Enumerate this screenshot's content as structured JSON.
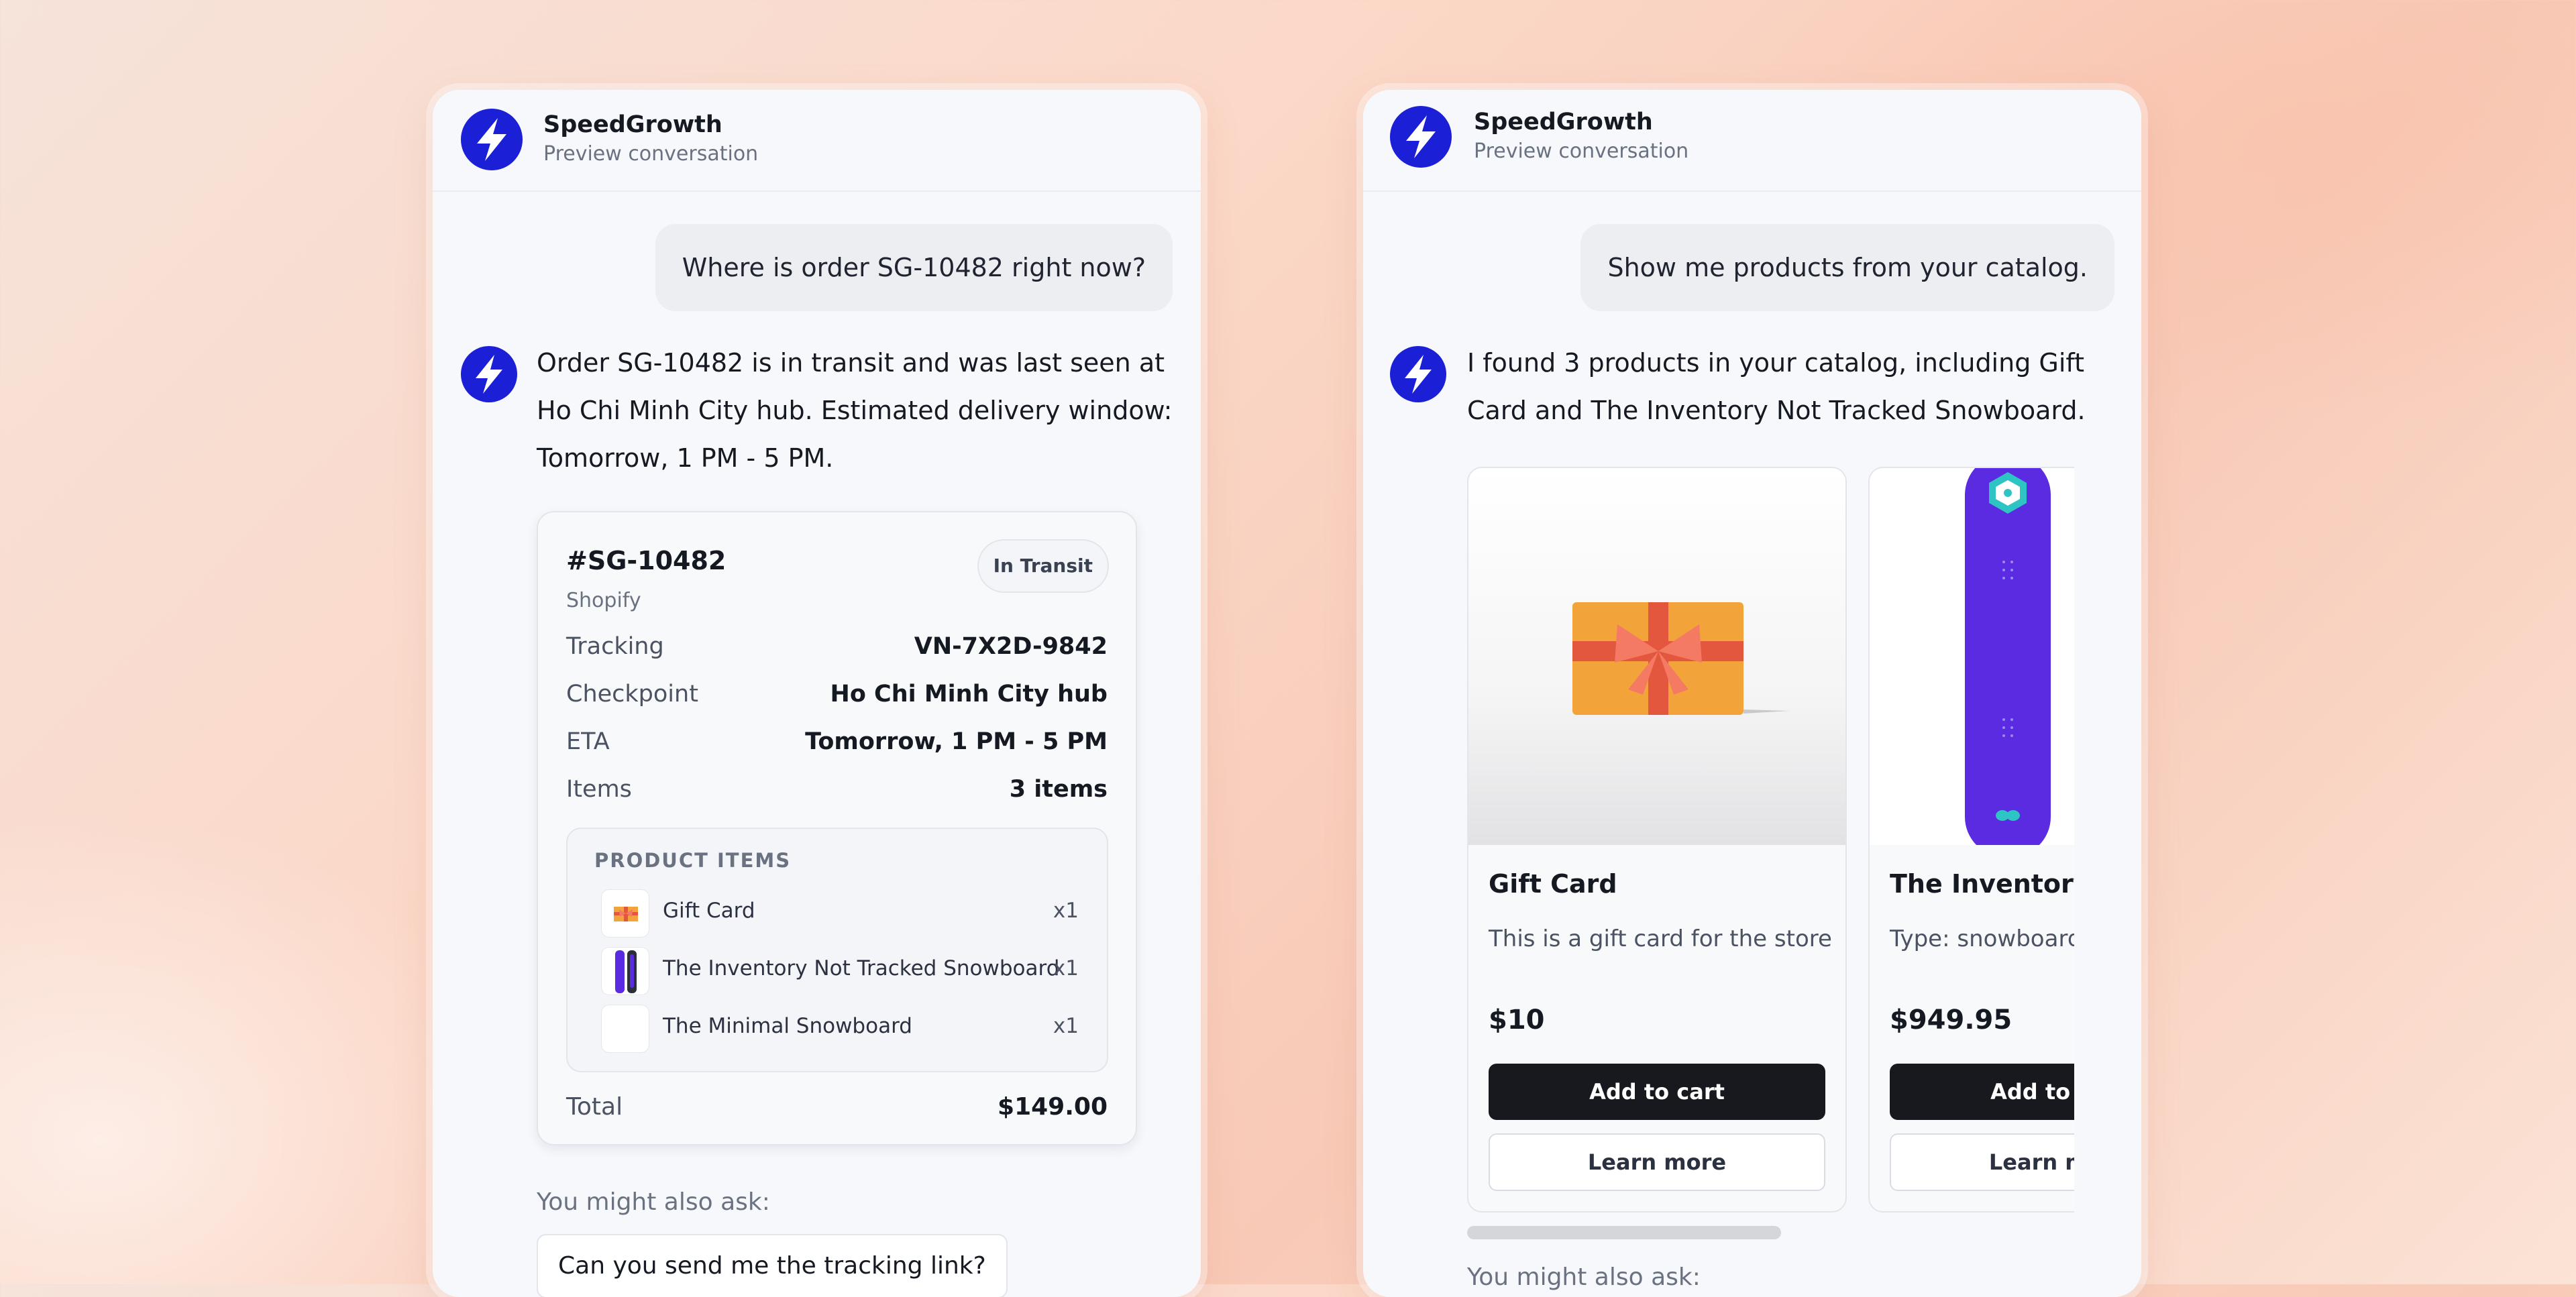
{
  "colors": {
    "brand": "#1b1fd6",
    "button_dark": "#17191f",
    "background": "#fbd8c8"
  },
  "left": {
    "header": {
      "title": "SpeedGrowth",
      "subtitle": "Preview conversation",
      "logo_icon": "lightning-bolt-icon"
    },
    "user_message": "Where is order SG-10482 right now?",
    "bot_message": {
      "lines": [
        "Order SG-10482 is in transit and was last seen at",
        "Ho Chi Minh City hub. Estimated delivery window:",
        "Tomorrow, 1 PM - 5 PM."
      ]
    },
    "order": {
      "id": "#SG-10482",
      "source": "Shopify",
      "status": "In Transit",
      "fields": [
        {
          "label": "Tracking",
          "value": "VN-7X2D-9842"
        },
        {
          "label": "Checkpoint",
          "value": "Ho Chi Minh City hub"
        },
        {
          "label": "ETA",
          "value": "Tomorrow, 1 PM - 5 PM"
        },
        {
          "label": "Items",
          "value": "3 items"
        }
      ],
      "items_title": "PRODUCT ITEMS",
      "items": [
        {
          "name": "Gift Card",
          "qty": "x1"
        },
        {
          "name": "The Inventory Not Tracked Snowboard",
          "qty": "x1"
        },
        {
          "name": "The Minimal Snowboard",
          "qty": "x1"
        }
      ],
      "total_label": "Total",
      "total_value": "$149.00"
    },
    "suggestions_title": "You might also ask:",
    "suggestion": "Can you send me the tracking link?"
  },
  "right": {
    "header": {
      "title": "SpeedGrowth",
      "subtitle": "Preview conversation",
      "logo_icon": "lightning-bolt-icon"
    },
    "user_message": "Show me products from your catalog.",
    "bot_message": {
      "lines": [
        "I found 3 products in your catalog, including Gift",
        "Card and The Inventory Not Tracked Snowboard."
      ]
    },
    "products": [
      {
        "title": "Gift Card",
        "description": "This is a gift card for the store",
        "price": "$10",
        "add_label": "Add to cart",
        "more_label": "Learn more"
      },
      {
        "title": "The Inventory Not Tracked Snowboard",
        "description": "Type: snowboard",
        "price": "$949.95",
        "add_label": "Add to cart",
        "more_label": "Learn more"
      }
    ],
    "suggestions_title": "You might also ask:"
  }
}
